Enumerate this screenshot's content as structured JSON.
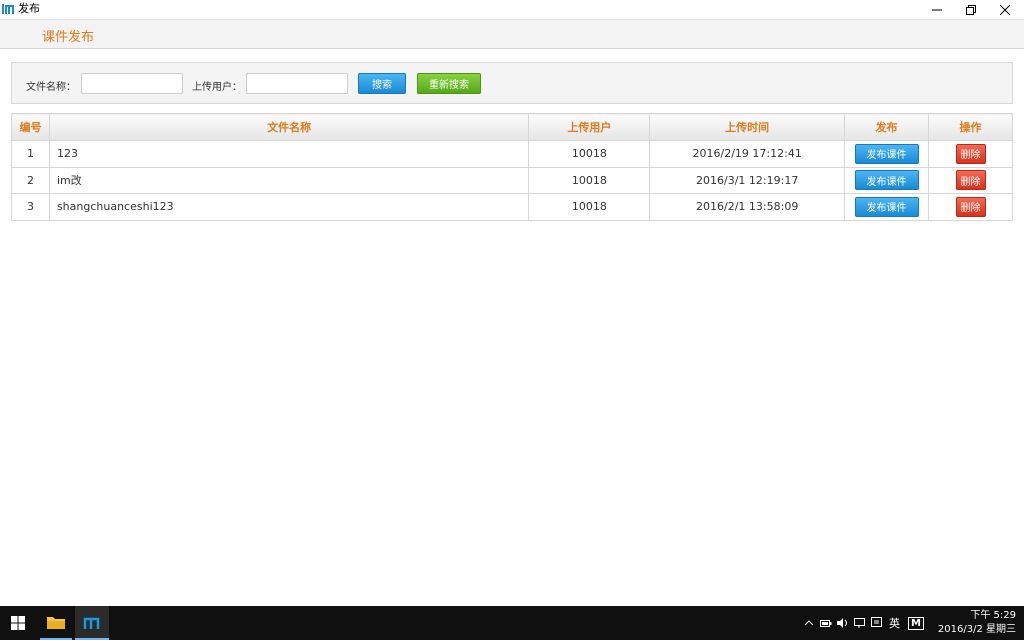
{
  "window": {
    "title": "发布",
    "controls": {
      "minimize": "minimize-icon",
      "restore": "restore-icon",
      "close": "close-icon"
    }
  },
  "header": {
    "page_title": "课件发布"
  },
  "search": {
    "file_name_label": "文件名称：",
    "file_name_value": "",
    "uploader_label": "上传用户：",
    "uploader_value": "",
    "search_button": "搜索",
    "reset_button": "重新搜索"
  },
  "table": {
    "columns": [
      "编号",
      "文件名称",
      "上传用户",
      "上传时间",
      "发布",
      "操作"
    ],
    "rows": [
      {
        "id": "1",
        "name": "123",
        "user": "10018",
        "time": "2016/2/19 17:12:41",
        "publish": "发布课件",
        "action": "删除"
      },
      {
        "id": "2",
        "name": "im改",
        "user": "10018",
        "time": "2016/3/1 12:19:17",
        "publish": "发布课件",
        "action": "删除"
      },
      {
        "id": "3",
        "name": "shangchuanceshi123",
        "user": "10018",
        "time": "2016/2/1 13:58:09",
        "publish": "发布课件",
        "action": "删除"
      }
    ]
  },
  "taskbar": {
    "ime": "英",
    "ime2": "M",
    "time": "下午 5:29",
    "date": "2016/3/2 星期三"
  },
  "colors": {
    "accent": "#e07b1a",
    "blue": "#1a8ad6",
    "green": "#57a81a",
    "red": "#d6321d"
  }
}
